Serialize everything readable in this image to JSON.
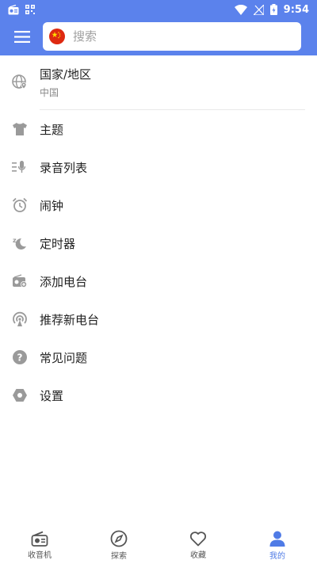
{
  "status_bar": {
    "time": "9:54"
  },
  "header": {
    "search_placeholder": "搜索"
  },
  "region": {
    "title": "国家/地区",
    "value": "中国"
  },
  "menu": [
    {
      "label": "主题",
      "icon": "tshirt-icon"
    },
    {
      "label": "录音列表",
      "icon": "mic-list-icon"
    },
    {
      "label": "闹钟",
      "icon": "alarm-clock-icon"
    },
    {
      "label": "定时器",
      "icon": "sleep-timer-icon"
    },
    {
      "label": "添加电台",
      "icon": "add-radio-icon"
    },
    {
      "label": "推荐新电台",
      "icon": "broadcast-icon"
    },
    {
      "label": "常见问题",
      "icon": "help-icon"
    },
    {
      "label": "设置",
      "icon": "settings-icon"
    }
  ],
  "bottom_nav": [
    {
      "label": "收音机",
      "icon": "radio-icon"
    },
    {
      "label": "探索",
      "icon": "compass-icon"
    },
    {
      "label": "收藏",
      "icon": "heart-icon"
    },
    {
      "label": "我的",
      "icon": "person-icon",
      "active": true
    }
  ],
  "colors": {
    "accent": "#5b82ec",
    "active_nav": "#4f7be6",
    "icon_gray": "#9a9a9a"
  }
}
